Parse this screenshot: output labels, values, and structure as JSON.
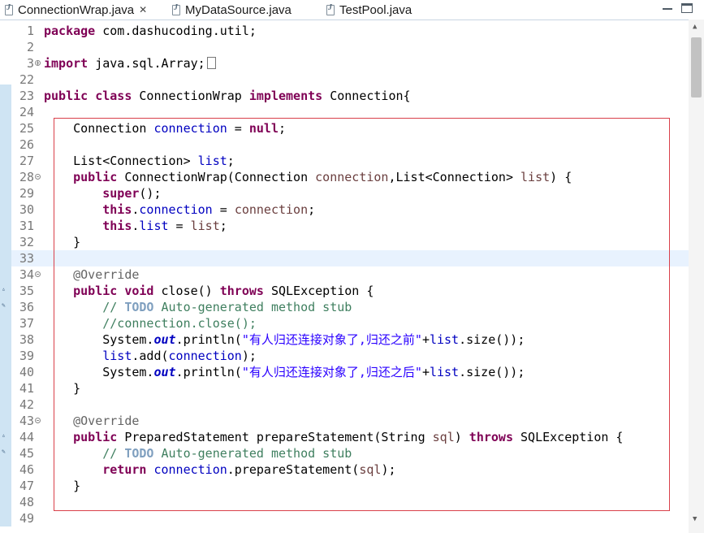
{
  "tabs": [
    {
      "label": "ConnectionWrap.java",
      "active": true,
      "icon": "java-file-icon",
      "close": "✕"
    },
    {
      "label": "MyDataSource.java",
      "active": false,
      "icon": "java-file-icon"
    },
    {
      "label": "TestPool.java",
      "active": false,
      "icon": "java-file-icon"
    }
  ],
  "lines": [
    {
      "n": "1",
      "fold": "",
      "tokens": [
        [
          "kw",
          "package"
        ],
        [
          "",
          " com.dashucoding.util;"
        ]
      ]
    },
    {
      "n": "2",
      "fold": "",
      "tokens": []
    },
    {
      "n": "3",
      "fold": "expand",
      "tokens": [
        [
          "kw",
          "import"
        ],
        [
          "",
          " java.sql.Array;"
        ]
      ],
      "collapsed": true
    },
    {
      "n": "22",
      "fold": "",
      "tokens": []
    },
    {
      "n": "23",
      "fold": "",
      "tokens": [
        [
          "kw",
          "public"
        ],
        [
          "",
          " "
        ],
        [
          "kw",
          "class"
        ],
        [
          "",
          " ConnectionWrap "
        ],
        [
          "kw",
          "implements"
        ],
        [
          "",
          " Connection{"
        ]
      ]
    },
    {
      "n": "24",
      "fold": "",
      "tokens": []
    },
    {
      "n": "25",
      "fold": "",
      "tokens": [
        [
          "",
          "    Connection "
        ],
        [
          "fld",
          "connection"
        ],
        [
          "",
          " = "
        ],
        [
          "kw",
          "null"
        ],
        [
          "",
          ";"
        ]
      ]
    },
    {
      "n": "26",
      "fold": "",
      "tokens": []
    },
    {
      "n": "27",
      "fold": "",
      "tokens": [
        [
          "",
          "    List<Connection> "
        ],
        [
          "fld",
          "list"
        ],
        [
          "",
          ";"
        ]
      ]
    },
    {
      "n": "28",
      "fold": "collapse",
      "tokens": [
        [
          "",
          "    "
        ],
        [
          "kw",
          "public"
        ],
        [
          "",
          " ConnectionWrap(Connection "
        ],
        [
          "prm",
          "connection"
        ],
        [
          "",
          ",List<Connection> "
        ],
        [
          "prm",
          "list"
        ],
        [
          "",
          ") {"
        ]
      ]
    },
    {
      "n": "29",
      "fold": "",
      "tokens": [
        [
          "",
          "        "
        ],
        [
          "kw",
          "super"
        ],
        [
          "",
          "();"
        ]
      ]
    },
    {
      "n": "30",
      "fold": "",
      "tokens": [
        [
          "",
          "        "
        ],
        [
          "kw",
          "this"
        ],
        [
          "",
          "."
        ],
        [
          "fld",
          "connection"
        ],
        [
          "",
          " = "
        ],
        [
          "prm",
          "connection"
        ],
        [
          "",
          ";"
        ]
      ]
    },
    {
      "n": "31",
      "fold": "",
      "tokens": [
        [
          "",
          "        "
        ],
        [
          "kw",
          "this"
        ],
        [
          "",
          "."
        ],
        [
          "fld",
          "list"
        ],
        [
          "",
          " = "
        ],
        [
          "prm",
          "list"
        ],
        [
          "",
          ";"
        ]
      ]
    },
    {
      "n": "32",
      "fold": "",
      "tokens": [
        [
          "",
          "    }"
        ]
      ]
    },
    {
      "n": "33",
      "fold": "",
      "tokens": [],
      "current": true
    },
    {
      "n": "34",
      "fold": "collapse",
      "tokens": [
        [
          "",
          "    "
        ],
        [
          "ann",
          "@Override"
        ]
      ]
    },
    {
      "n": "35",
      "fold": "",
      "tokens": [
        [
          "",
          "    "
        ],
        [
          "kw",
          "public"
        ],
        [
          "",
          " "
        ],
        [
          "kw",
          "void"
        ],
        [
          "",
          " close() "
        ],
        [
          "kw",
          "throws"
        ],
        [
          "",
          " SQLException {"
        ]
      ]
    },
    {
      "n": "36",
      "fold": "",
      "tokens": [
        [
          "",
          "        "
        ],
        [
          "cmt",
          "// "
        ],
        [
          "todo",
          "TODO"
        ],
        [
          "cmt",
          " Auto-generated method stub"
        ]
      ]
    },
    {
      "n": "37",
      "fold": "",
      "tokens": [
        [
          "",
          "        "
        ],
        [
          "cmt",
          "//connection.close();"
        ]
      ]
    },
    {
      "n": "38",
      "fold": "",
      "tokens": [
        [
          "",
          "        System."
        ],
        [
          "sfld",
          "out"
        ],
        [
          "",
          ".println("
        ],
        [
          "str",
          "\"有人归还连接对象了,归还之前\""
        ],
        [
          "",
          "+"
        ],
        [
          "fld",
          "list"
        ],
        [
          "",
          ".size());"
        ]
      ]
    },
    {
      "n": "39",
      "fold": "",
      "tokens": [
        [
          "",
          "        "
        ],
        [
          "fld",
          "list"
        ],
        [
          "",
          ".add("
        ],
        [
          "fld",
          "connection"
        ],
        [
          "",
          ");"
        ]
      ]
    },
    {
      "n": "40",
      "fold": "",
      "tokens": [
        [
          "",
          "        System."
        ],
        [
          "sfld",
          "out"
        ],
        [
          "",
          ".println("
        ],
        [
          "str",
          "\"有人归还连接对象了,归还之后\""
        ],
        [
          "",
          "+"
        ],
        [
          "fld",
          "list"
        ],
        [
          "",
          ".size());"
        ]
      ]
    },
    {
      "n": "41",
      "fold": "",
      "tokens": [
        [
          "",
          "    }"
        ]
      ]
    },
    {
      "n": "42",
      "fold": "",
      "tokens": []
    },
    {
      "n": "43",
      "fold": "collapse",
      "tokens": [
        [
          "",
          "    "
        ],
        [
          "ann",
          "@Override"
        ]
      ]
    },
    {
      "n": "44",
      "fold": "",
      "tokens": [
        [
          "",
          "    "
        ],
        [
          "kw",
          "public"
        ],
        [
          "",
          " PreparedStatement prepareStatement(String "
        ],
        [
          "prm",
          "sql"
        ],
        [
          "",
          ") "
        ],
        [
          "kw",
          "throws"
        ],
        [
          "",
          " SQLException {"
        ]
      ]
    },
    {
      "n": "45",
      "fold": "",
      "tokens": [
        [
          "",
          "        "
        ],
        [
          "cmt",
          "// "
        ],
        [
          "todo",
          "TODO"
        ],
        [
          "cmt",
          " Auto-generated method stub"
        ]
      ]
    },
    {
      "n": "46",
      "fold": "",
      "tokens": [
        [
          "",
          "        "
        ],
        [
          "kw",
          "return"
        ],
        [
          "",
          " "
        ],
        [
          "fld",
          "connection"
        ],
        [
          "",
          ".prepareStatement("
        ],
        [
          "prm",
          "sql"
        ],
        [
          "",
          ");"
        ]
      ]
    },
    {
      "n": "47",
      "fold": "",
      "tokens": [
        [
          "",
          "    }"
        ]
      ]
    },
    {
      "n": "48",
      "fold": "",
      "tokens": []
    },
    {
      "n": "49",
      "fold": "",
      "tokens": []
    }
  ],
  "colors": {
    "keyword": "#7f0055",
    "field": "#0000c0",
    "string": "#2a00ff",
    "comment": "#3f7f5f",
    "highlight_box": "#d9404a"
  }
}
